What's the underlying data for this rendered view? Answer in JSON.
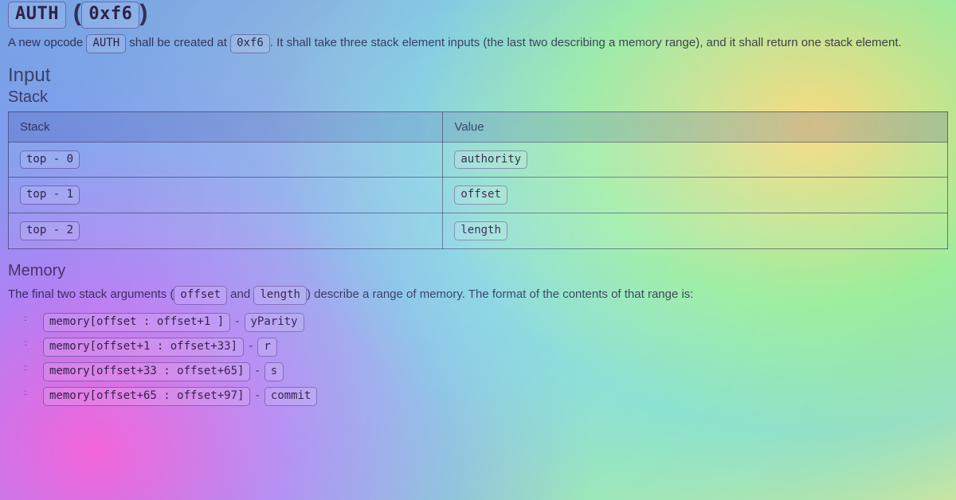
{
  "title": {
    "name": "AUTH",
    "hex_open": "(",
    "hex": "0xf6",
    "hex_close": ")"
  },
  "intro": {
    "p1a": "A new opcode ",
    "p1_code1": "AUTH",
    "p1b": " shall be created at ",
    "p1_code2": "0xf6",
    "p1c": ". It shall take three stack element inputs (the last two describing a memory range), and it shall return one stack element."
  },
  "input_heading": "Input",
  "stack_heading": "Stack",
  "stack_table": {
    "headers": [
      "Stack",
      "Value"
    ],
    "rows": [
      {
        "stack": "top - 0",
        "value": "authority"
      },
      {
        "stack": "top - 1",
        "value": "offset"
      },
      {
        "stack": "top - 2",
        "value": "length"
      }
    ]
  },
  "memory_heading": "Memory",
  "memory_para": {
    "a": "The final two stack arguments (",
    "code1": "offset",
    "b": " and ",
    "code2": "length",
    "c": ") describe a range of memory. The format of the contents of that range is:"
  },
  "memory_items": [
    {
      "code": "memory[offset : offset+1 ]",
      "label": "yParity"
    },
    {
      "code": "memory[offset+1 : offset+33]",
      "label": "r"
    },
    {
      "code": "memory[offset+33 : offset+65]",
      "label": "s"
    },
    {
      "code": "memory[offset+65 : offset+97]",
      "label": "commit"
    }
  ]
}
